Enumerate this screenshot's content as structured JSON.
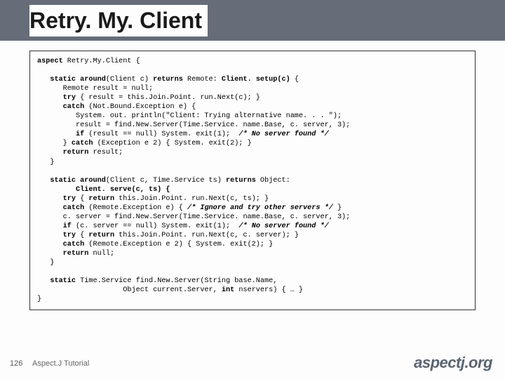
{
  "title": "Retry. My. Client",
  "code": {
    "l1a": "aspect",
    "l1b": " Retry.My.Client {",
    "l2a": "   static around",
    "l2b": "(Client c) ",
    "l2c": "returns",
    "l2d": " Remote: ",
    "l2e": "Client. setup(c)",
    "l2f": " {",
    "l3": "      Remote result = null;",
    "l4a": "      try",
    "l4b": " { result = this.Join.Point. run.Next(c); }",
    "l5a": "      catch",
    "l5b": " (Not.Bound.Exception e) {",
    "l6": "         System. out. println(\"Client: Trying alternative name. . . \");",
    "l7": "         result = find.New.Server(Time.Service. name.Base, c. server, 3);",
    "l8a": "         if",
    "l8b": " (result == null) System. exit(1);  ",
    "l8c": "/* No server found */",
    "l9a": "      } ",
    "l9b": "catch",
    "l9c": " (Exception e 2) { System. exit(2); }",
    "l10a": "      return",
    "l10b": " result;",
    "l11": "   }",
    "l20a": "   static around",
    "l20b": "(Client c, Time.Service ts) ",
    "l20c": "returns",
    "l20d": " Object:",
    "l21": "         Client. serve(c, ts) {",
    "l22a": "      try",
    "l22b": " { ",
    "l22c": "return",
    "l22d": " this.Join.Point. run.Next(c, ts); }",
    "l23a": "      catch",
    "l23b": " (Remote.Exception e) { ",
    "l23c": "/* Ignore and try other servers */",
    "l23d": " }",
    "l24": "      c. server = find.New.Server(Time.Service. name.Base, c. server, 3);",
    "l25a": "      if",
    "l25b": " (c. server == null) System. exit(1);  ",
    "l25c": "/* No server found */",
    "l26a": "      try",
    "l26b": " { ",
    "l26c": "return",
    "l26d": " this.Join.Point. run.Next(c, c. server); }",
    "l27a": "      catch",
    "l27b": " (Remote.Exception e 2) { System. exit(2); }",
    "l28a": "      return",
    "l28b": " null;",
    "l29": "   }",
    "l30a": "   static",
    "l30b": " Time.Service find.New.Server(String base.Name,",
    "l31a": "                    Object current.Server, ",
    "l31b": "int",
    "l31c": " nservers) { … }",
    "l32": "}"
  },
  "footer": {
    "page": "126",
    "label": "Aspect.J Tutorial",
    "logo": "aspectj.org"
  }
}
